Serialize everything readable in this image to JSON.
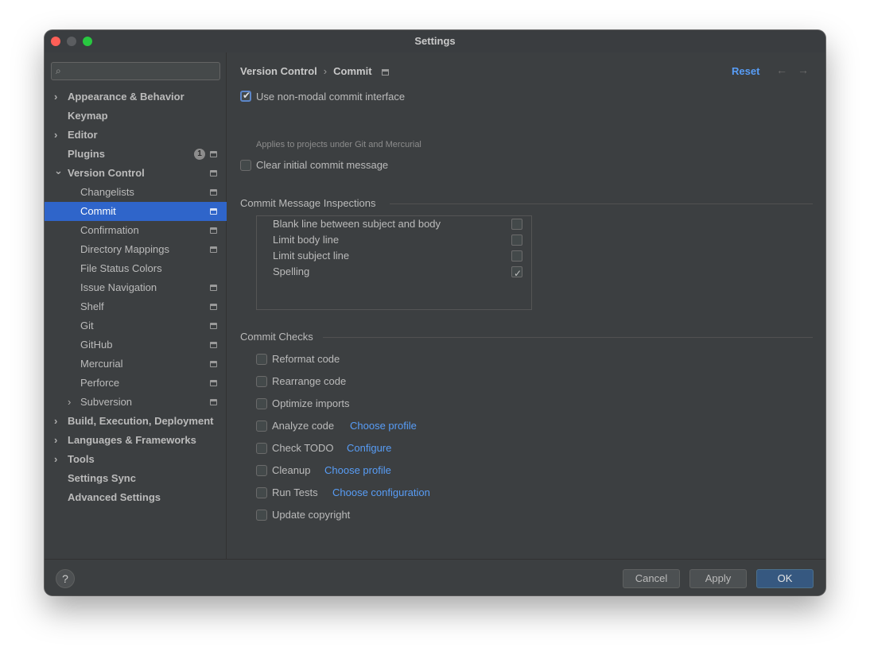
{
  "window": {
    "title": "Settings"
  },
  "sidebar": {
    "search_placeholder": "",
    "items": [
      {
        "label": "Appearance & Behavior",
        "bold": true,
        "expander": "›"
      },
      {
        "label": "Keymap",
        "bold": true
      },
      {
        "label": "Editor",
        "bold": true,
        "expander": "›"
      },
      {
        "label": "Plugins",
        "bold": true,
        "badge": "1"
      },
      {
        "label": "Version Control",
        "bold": true,
        "expander": "⌄"
      },
      {
        "label": "Changelists"
      },
      {
        "label": "Commit"
      },
      {
        "label": "Confirmation"
      },
      {
        "label": "Directory Mappings"
      },
      {
        "label": "File Status Colors"
      },
      {
        "label": "Issue Navigation"
      },
      {
        "label": "Shelf"
      },
      {
        "label": "Git"
      },
      {
        "label": "GitHub"
      },
      {
        "label": "Mercurial"
      },
      {
        "label": "Perforce"
      },
      {
        "label": "Subversion",
        "expander": "›"
      },
      {
        "label": "Build, Execution, Deployment",
        "bold": true,
        "expander": "›"
      },
      {
        "label": "Languages & Frameworks",
        "bold": true,
        "expander": "›"
      },
      {
        "label": "Tools",
        "bold": true,
        "expander": "›"
      },
      {
        "label": "Settings Sync",
        "bold": true
      },
      {
        "label": "Advanced Settings",
        "bold": true
      }
    ]
  },
  "header": {
    "breadcrumb_parent": "Version Control",
    "breadcrumb_sep": "›",
    "breadcrumb_current": "Commit",
    "reset_label": "Reset",
    "back_arrow": "←",
    "forward_arrow": "→"
  },
  "options": {
    "non_modal": {
      "label": "Use non-modal commit interface",
      "checked": true,
      "hint": "Applies to projects under Git and Mercurial"
    },
    "clear_message": {
      "label": "Clear initial commit message",
      "checked": false
    }
  },
  "inspections": {
    "title": "Commit Message Inspections",
    "rows": [
      {
        "label": "Blank line between subject and body",
        "checked": false
      },
      {
        "label": "Limit body line",
        "checked": false
      },
      {
        "label": "Limit subject line",
        "checked": false
      },
      {
        "label": "Spelling",
        "checked": true
      }
    ]
  },
  "checks": {
    "title": "Commit Checks",
    "rows": [
      {
        "label": "Reformat code",
        "checked": false,
        "link": ""
      },
      {
        "label": "Rearrange code",
        "checked": false,
        "link": ""
      },
      {
        "label": "Optimize imports",
        "checked": false,
        "link": ""
      },
      {
        "label": "Analyze code",
        "checked": false,
        "link": "Choose profile"
      },
      {
        "label": "Check TODO",
        "checked": false,
        "link": "Configure"
      },
      {
        "label": "Cleanup",
        "checked": false,
        "link": "Choose profile"
      },
      {
        "label": "Run Tests",
        "checked": false,
        "link": "Choose configuration"
      },
      {
        "label": "Update copyright",
        "checked": false,
        "link": ""
      }
    ]
  },
  "footer": {
    "help_label": "?",
    "cancel_label": "Cancel",
    "apply_label": "Apply",
    "ok_label": "OK"
  },
  "colors": {
    "background": "#3c3f41",
    "selection": "#2f65ca",
    "link": "#589df6",
    "primary_button": "#365880"
  }
}
